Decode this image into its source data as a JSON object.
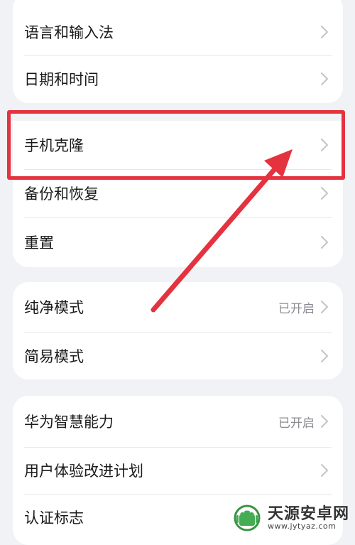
{
  "group1": {
    "items": [
      {
        "label": "语言和输入法"
      },
      {
        "label": "日期和时间"
      },
      {
        "label": "手机克隆"
      },
      {
        "label": "备份和恢复"
      },
      {
        "label": "重置"
      }
    ]
  },
  "group2": {
    "items": [
      {
        "label": "纯净模式",
        "value": "已开启"
      },
      {
        "label": "简易模式"
      }
    ]
  },
  "group3": {
    "items": [
      {
        "label": "华为智慧能力",
        "value": "已开启"
      },
      {
        "label": "用户体验改进计划"
      },
      {
        "label": "认证标志"
      }
    ]
  },
  "annotation": {
    "color": "#e4323f"
  },
  "watermark": {
    "title": "天源安卓网",
    "url": "www.jytyaz.com"
  }
}
